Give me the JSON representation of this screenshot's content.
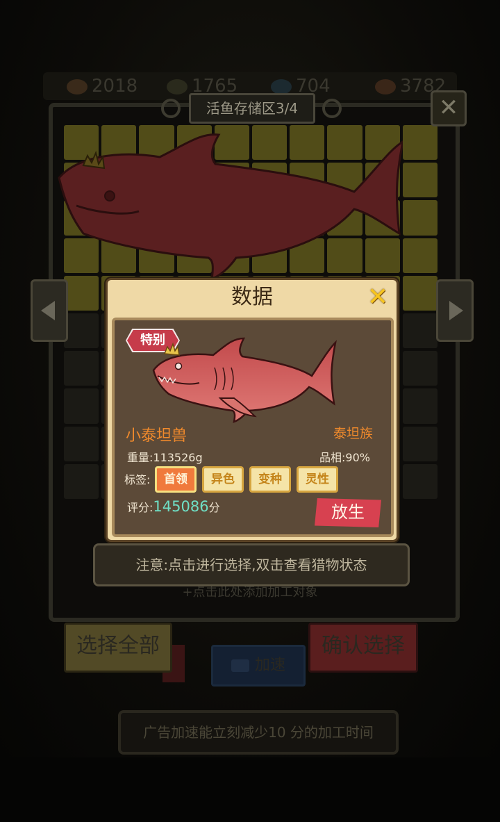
{
  "resources": [
    {
      "icon": "wood-icon",
      "value": "2018"
    },
    {
      "icon": "coin-icon",
      "value": "1765"
    },
    {
      "icon": "fish-icon",
      "value": "704"
    },
    {
      "icon": "meat-icon",
      "value": "3782"
    }
  ],
  "storage": {
    "title": "活鱼存储区3/4",
    "close_label": "✕"
  },
  "background": {
    "add_target": "+点击此处添加加工对象",
    "select_all": "选择全部",
    "confirm": "确认选择",
    "speed": "加速",
    "ad_hint": "广告加速能立刻减少10 分的加工时间"
  },
  "modal": {
    "title": "数据",
    "close_label": "✕",
    "badge": "特别",
    "name": "小泰坦兽",
    "family": "泰坦族",
    "weight": "重量:113526g",
    "quality": "品相:90%",
    "tags_label": "标签:",
    "tags": [
      "首领",
      "异色",
      "变种",
      "灵性"
    ],
    "score_label": "评分:",
    "score_value": "145086",
    "score_unit": "分",
    "release": "放生"
  },
  "notice": "注意:点击进行选择,双击查看猎物状态",
  "colors": {
    "accent_orange": "#f08a2c",
    "score_teal": "#6fe0c6",
    "shark_red": "#c24a4c",
    "release_red": "#d74150"
  }
}
